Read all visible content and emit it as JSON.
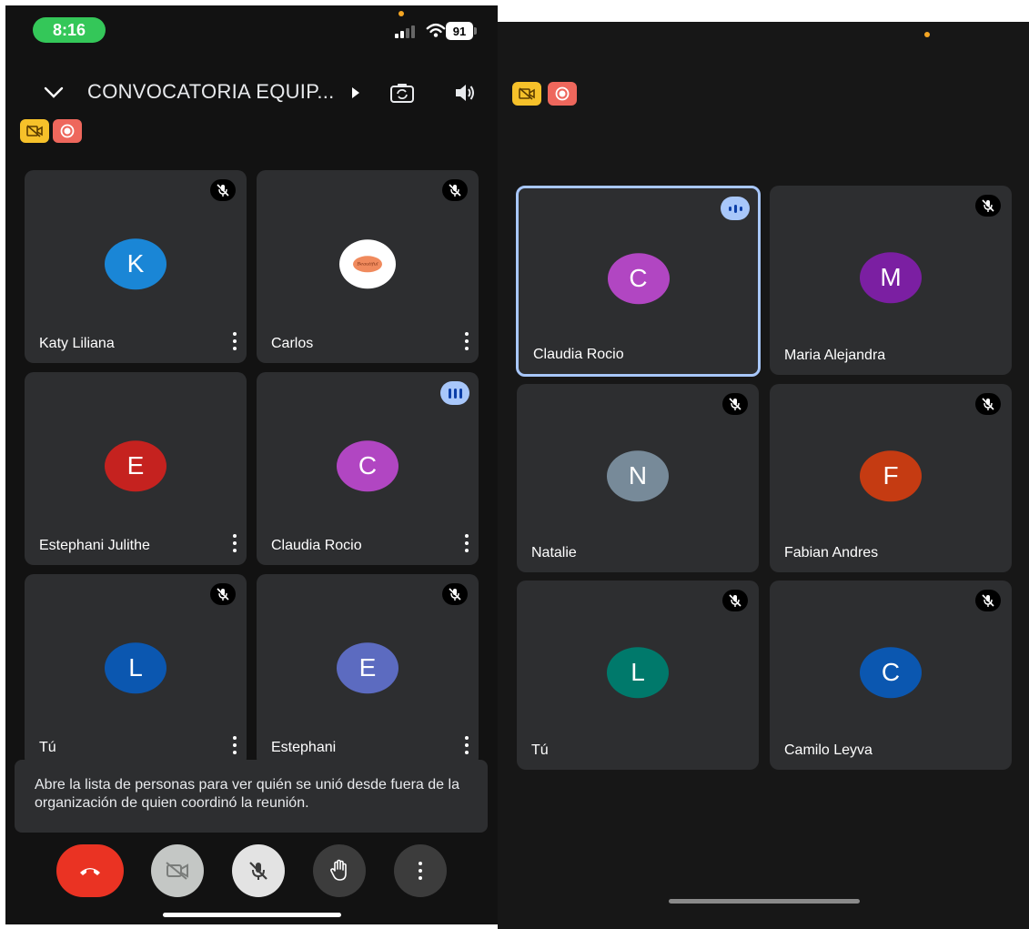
{
  "status_bar": {
    "time": "8:16",
    "battery": "91"
  },
  "header": {
    "title": "CONVOCATORIA EQUIP...",
    "icons": [
      "chevron-down-icon",
      "chevron-right-icon",
      "flip-camera-icon",
      "speaker-icon"
    ]
  },
  "badges": [
    "no-recording-camera-icon",
    "recording-icon"
  ],
  "left_grid": [
    {
      "name": "Katy Liliana",
      "initial": "K",
      "color": "#1a86d6",
      "status": "muted"
    },
    {
      "name": "Carlos",
      "initial": "Beautiful",
      "color": "#ffffff",
      "status": "muted",
      "logo": true
    },
    {
      "name": "Estephani Julithe",
      "initial": "E",
      "color": "#c5221f",
      "status": "none"
    },
    {
      "name": "Claudia Rocio",
      "initial": "C",
      "color": "#b146c2",
      "status": "speaking"
    },
    {
      "name": "Tú",
      "initial": "L",
      "color": "#0b57b0",
      "status": "muted"
    },
    {
      "name": "Estephani",
      "initial": "E",
      "color": "#5c6bc0",
      "status": "muted"
    }
  ],
  "right_grid": [
    {
      "name": "Claudia Rocio",
      "initial": "C",
      "color": "#b146c2",
      "status": "speaking",
      "active": true
    },
    {
      "name": "Maria Alejandra",
      "initial": "M",
      "color": "#7b1fa2",
      "status": "muted"
    },
    {
      "name": "Natalie",
      "initial": "N",
      "color": "#778a99",
      "status": "muted"
    },
    {
      "name": "Fabian Andres",
      "initial": "F",
      "color": "#c53b12",
      "status": "muted"
    },
    {
      "name": "Tú",
      "initial": "L",
      "color": "#00796b",
      "status": "muted"
    },
    {
      "name": "Camilo Leyva",
      "initial": "C",
      "color": "#0b57b0",
      "status": "muted"
    }
  ],
  "toast": {
    "text": "Abre la lista de personas para ver quién se unió desde fuera de la organización de quien coordinó la reunión."
  },
  "controls": [
    "end-call-icon",
    "camera-off-icon",
    "mic-off-icon",
    "raise-hand-icon",
    "more-options-icon"
  ],
  "colors": {
    "end_call": "#ea3323",
    "speaking": "#a8c7fa",
    "badge_yellow": "#f6c12a",
    "badge_red": "#ee675c"
  }
}
